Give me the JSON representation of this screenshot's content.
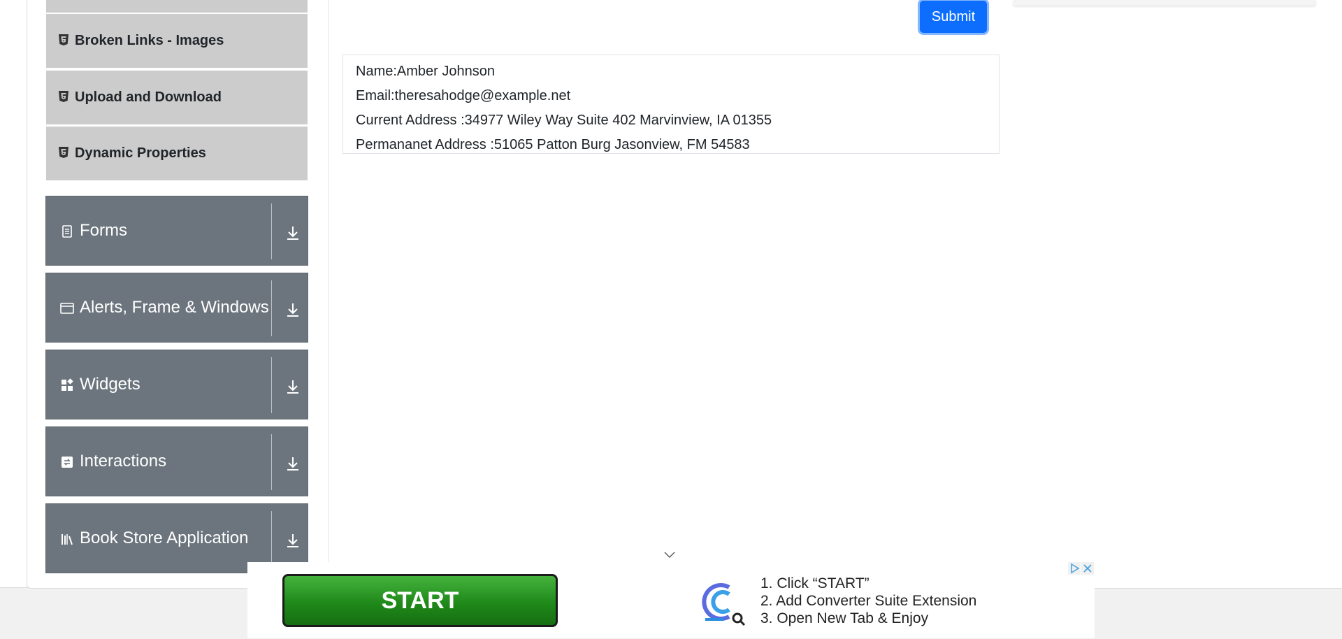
{
  "sidebar": {
    "sub_items": [
      {
        "label": "Broken Links - Images",
        "icon": "html5-icon"
      },
      {
        "label": "Upload and Download",
        "icon": "html5-icon"
      },
      {
        "label": "Dynamic Properties",
        "icon": "html5-icon"
      }
    ],
    "groups": [
      {
        "label": "Forms",
        "icon": "document-icon"
      },
      {
        "label": "Alerts, Frame & Windows",
        "icon": "window-icon"
      },
      {
        "label": "Widgets",
        "icon": "widgets-icon"
      },
      {
        "label": "Interactions",
        "icon": "interaction-icon"
      },
      {
        "label": "Book Store Application",
        "icon": "books-icon"
      }
    ]
  },
  "form": {
    "submit_label": "Submit"
  },
  "output": {
    "name": "Name:Amber Johnson",
    "email": "Email:theresahodge@example.net",
    "current_address": "Current Address :34977 Wiley Way Suite 402 Marvinview, IA 01355",
    "permanent_address": "Permananet Address :51065 Patton Burg Jasonview, FM 54583"
  },
  "ad": {
    "start_label": "START",
    "steps": [
      "1. Click “START”",
      "2. Add Converter Suite Extension",
      "3. Open New Tab & Enjoy"
    ]
  },
  "colors": {
    "group_bg": "#6c757d",
    "sub_item_bg": "#cccccc",
    "submit_bg": "#0d6efd",
    "start_green": "#1f8a1a"
  }
}
